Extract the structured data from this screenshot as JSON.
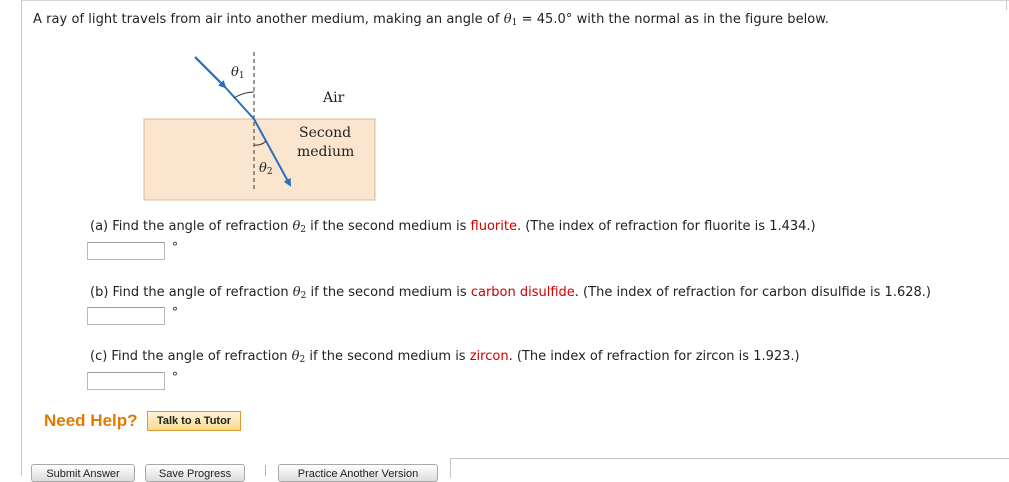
{
  "question": {
    "prefix": "A ray of light travels from air into another medium, making an angle of ",
    "theta_symbol": "θ",
    "theta1_sub": "1",
    "suffix": " = 45.0° with the normal as in the figure below."
  },
  "figure": {
    "theta1_symbol": "θ",
    "theta1_sub": "1",
    "theta2_symbol": "θ",
    "theta2_sub": "2",
    "air_label": "Air",
    "medium_label_line1": "Second",
    "medium_label_line2": "medium",
    "colors": {
      "medium_fill": "#fbe5cf",
      "medium_border": "#d9b895",
      "ray": "#2a6fbf"
    }
  },
  "parts": [
    {
      "lead": "(a) Find the angle of refraction ",
      "mid": " if the second medium is ",
      "material": "fluorite",
      "tail": ". (The index of refraction for fluorite is 1.434.)",
      "unit": "°",
      "value": ""
    },
    {
      "lead": "(b) Find the angle of refraction ",
      "mid": " if the second medium is ",
      "material": "carbon disulfide",
      "tail": ". (The index of refraction for carbon disulfide is 1.628.)",
      "unit": "°",
      "value": ""
    },
    {
      "lead": "(c) Find the angle of refraction ",
      "mid": " if the second medium is ",
      "material": "zircon",
      "tail": ". (The index of refraction for zircon is 1.923.)",
      "unit": "°",
      "value": ""
    }
  ],
  "theta2_symbol": "θ",
  "theta2_sub": "2",
  "help": {
    "need_help_label": "Need Help?",
    "talk_tutor_label": "Talk to a Tutor",
    "accent": "#e07b00"
  },
  "footer": {
    "submit_label": "Submit Answer",
    "save_label": "Save Progress",
    "practice_label": "Practice Another Version"
  }
}
